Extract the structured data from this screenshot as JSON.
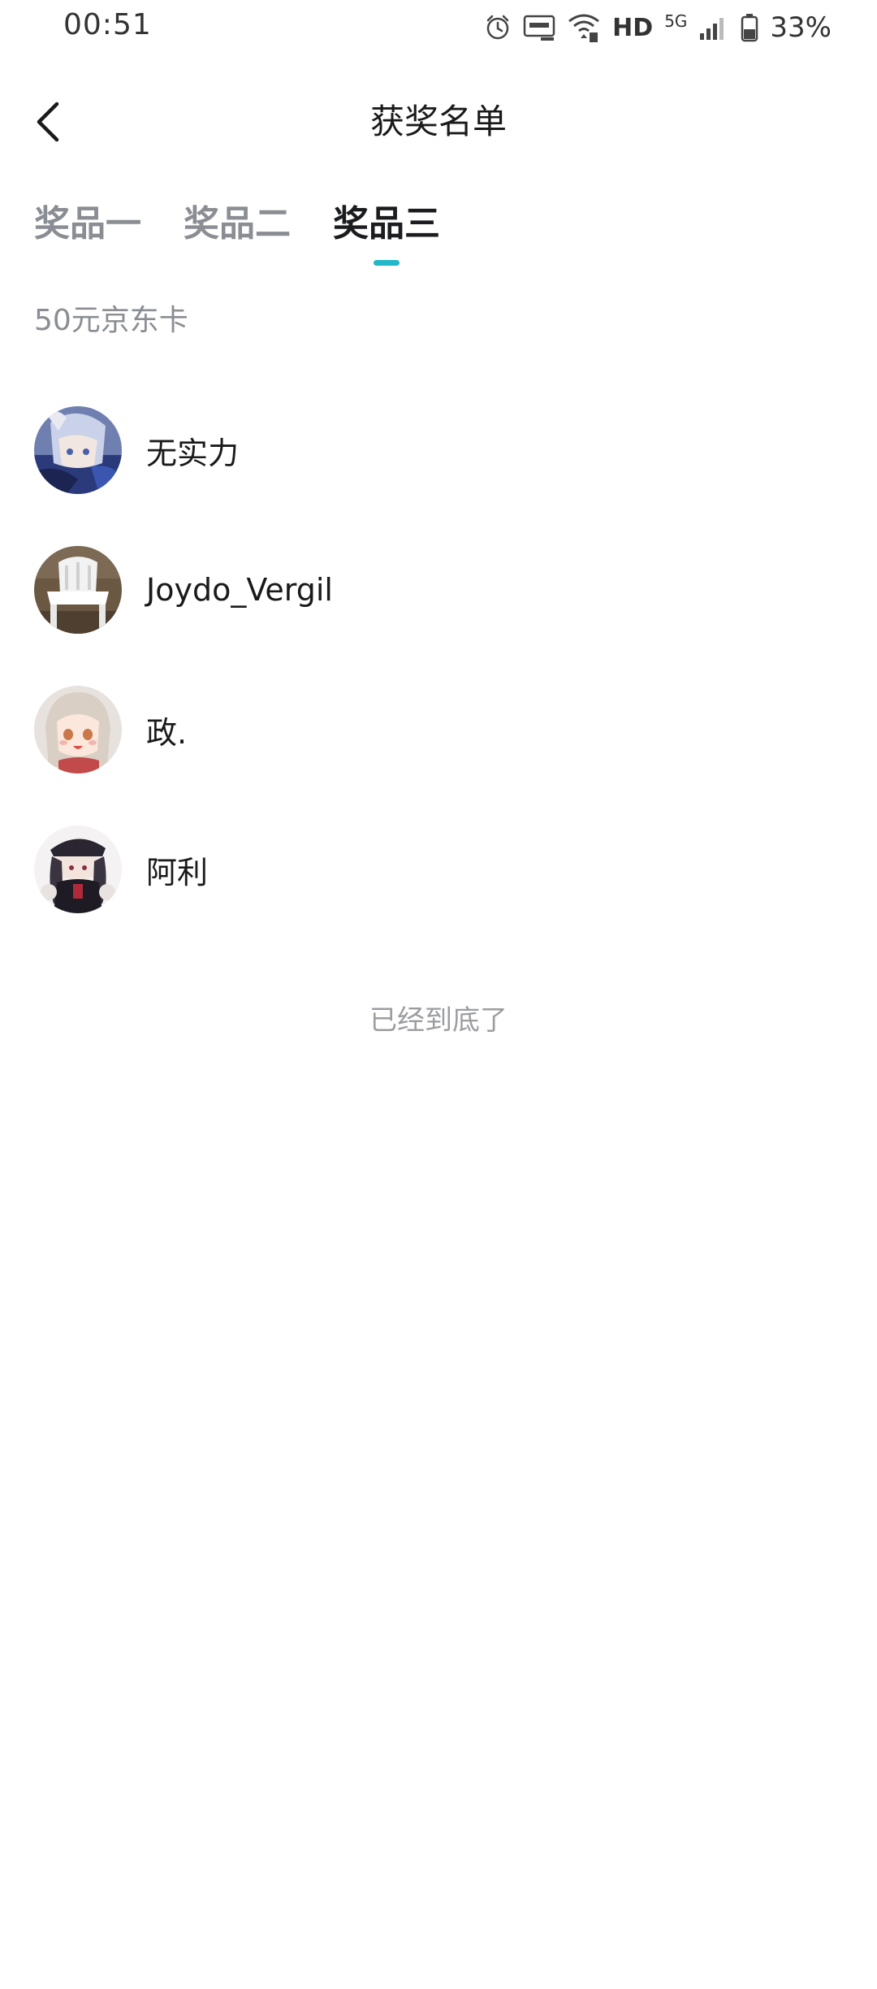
{
  "status_bar": {
    "time": "00:51",
    "hd": "HD",
    "network": "5G",
    "battery": "33%",
    "icons": [
      "alarm-icon",
      "auto-hz-icon",
      "wifi-6-icon",
      "signal-icon",
      "battery-icon"
    ]
  },
  "header": {
    "title": "获奖名单",
    "back_icon": "chevron-left-icon"
  },
  "tabs": [
    {
      "label": "奖品一",
      "active": false
    },
    {
      "label": "奖品二",
      "active": false
    },
    {
      "label": "奖品三",
      "active": true
    }
  ],
  "accent_color": "#22b8c9",
  "prize": {
    "name": "50元京东卡"
  },
  "winners": [
    {
      "name": "无实力",
      "avatar": "avatar-anime-blue-hair"
    },
    {
      "name": "Joydo_Vergil",
      "avatar": "avatar-white-chair"
    },
    {
      "name": "政.",
      "avatar": "avatar-anime-girl-light-hair"
    },
    {
      "name": "阿利",
      "avatar": "avatar-anime-girl-dark-hat"
    }
  ],
  "end_text": "已经到底了"
}
